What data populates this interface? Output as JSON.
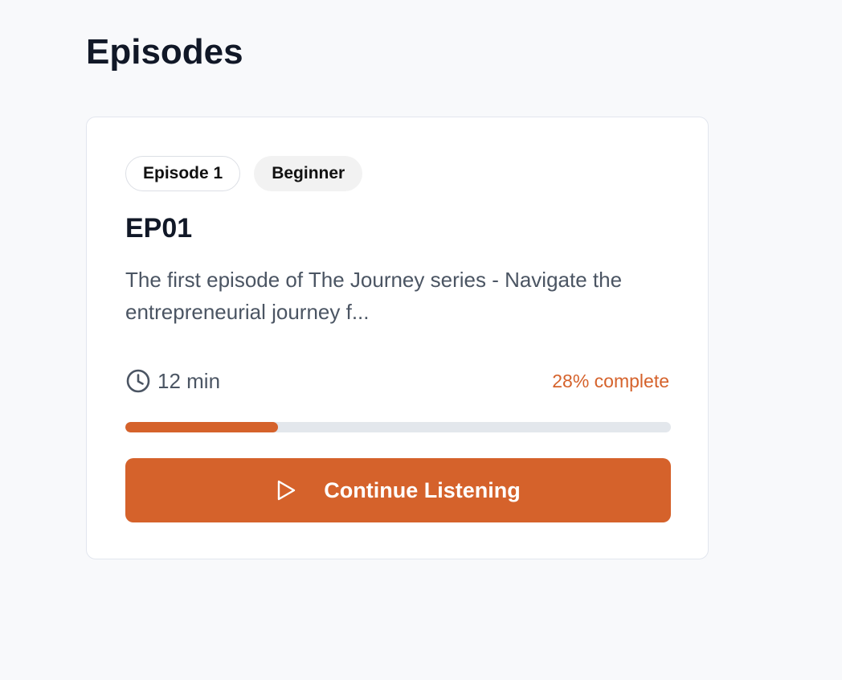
{
  "page": {
    "title": "Episodes"
  },
  "episode_card": {
    "badges": {
      "episode": "Episode 1",
      "level": "Beginner"
    },
    "title": "EP01",
    "description": "The first episode of The Journey series - Navigate the entrepreneurial journey f...",
    "duration": "12 min",
    "duration_icon": "clock-icon",
    "progress": {
      "percent": 28,
      "label": "28% complete"
    },
    "cta": {
      "label": "Continue Listening",
      "icon": "play-icon"
    }
  },
  "colors": {
    "accent": "#d5622b",
    "background": "#f8f9fb",
    "card": "#ffffff",
    "heading": "#111827",
    "body_text": "#4b5563",
    "track": "#e3e7ec"
  }
}
